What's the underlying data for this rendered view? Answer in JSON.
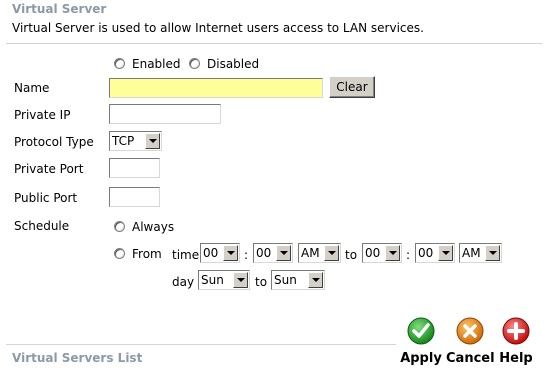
{
  "header": {
    "title": "Virtual Server",
    "description": "Virtual Server is used to allow Internet users access to LAN services."
  },
  "state": {
    "enabled_label": "Enabled",
    "disabled_label": "Disabled"
  },
  "form": {
    "name_label": "Name",
    "name_value": "",
    "clear_button": "Clear",
    "private_ip_label": "Private IP",
    "private_ip_value": "",
    "protocol_label": "Protocol Type",
    "protocol_value": "TCP",
    "private_port_label": "Private Port",
    "private_port_value": "",
    "public_port_label": "Public Port",
    "public_port_value": ""
  },
  "schedule": {
    "label": "Schedule",
    "always_label": "Always",
    "from_label": "From",
    "time_label": "time",
    "start_hour": "00",
    "start_minute": "00",
    "start_ampm": "AM",
    "to_label": "to",
    "end_hour": "00",
    "end_minute": "00",
    "end_ampm": "AM",
    "colon": ":",
    "day_label": "day",
    "start_day": "Sun",
    "end_day": "Sun"
  },
  "actions": {
    "apply": "Apply",
    "cancel": "Cancel",
    "help": "Help"
  },
  "list": {
    "title": "Virtual Servers List"
  },
  "colors": {
    "section_title": "#8c9aa8",
    "name_field_bg": "#ffff99",
    "apply_green": "#22a322",
    "cancel_orange": "#e07a10",
    "help_red": "#d01818"
  },
  "icons": {
    "apply": "check-icon",
    "cancel": "x-icon",
    "help": "plus-icon"
  }
}
